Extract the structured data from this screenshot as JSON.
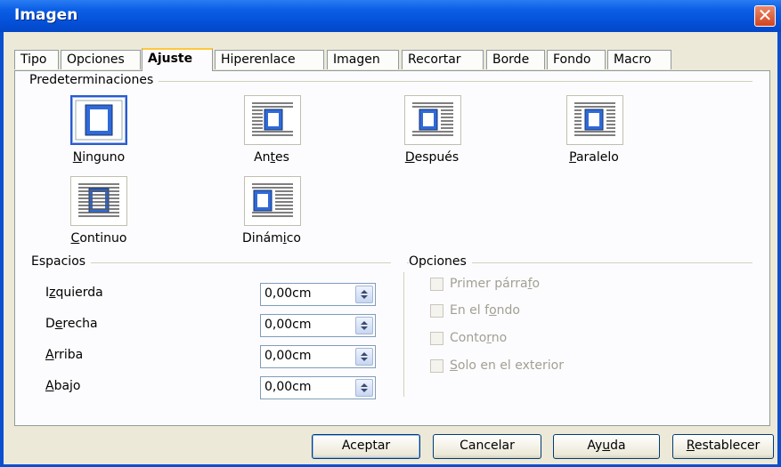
{
  "window": {
    "title": "Imagen"
  },
  "tabs": [
    {
      "label": "Tipo"
    },
    {
      "label": "Opciones"
    },
    {
      "label": "Ajuste"
    },
    {
      "label": "Hiperenlace"
    },
    {
      "label": "Imagen"
    },
    {
      "label": "Recortar"
    },
    {
      "label": "Borde"
    },
    {
      "label": "Fondo"
    },
    {
      "label": "Macro"
    }
  ],
  "active_tab": "Ajuste",
  "presets": {
    "group_label": "Predeterminaciones",
    "items": [
      {
        "pre": "",
        "u": "N",
        "post": "inguno",
        "icon": "wrap-none-icon"
      },
      {
        "pre": "An",
        "u": "t",
        "post": "es",
        "icon": "wrap-before-icon"
      },
      {
        "pre": "",
        "u": "D",
        "post": "espués",
        "icon": "wrap-after-icon"
      },
      {
        "pre": "",
        "u": "P",
        "post": "aralelo",
        "icon": "wrap-parallel-icon"
      },
      {
        "pre": "",
        "u": "C",
        "post": "ontinuo",
        "icon": "wrap-through-icon"
      },
      {
        "pre": "Dinám",
        "u": "i",
        "post": "co",
        "icon": "wrap-optimal-icon"
      }
    ],
    "selected": "Ninguno"
  },
  "spacing": {
    "group_label": "Espacios",
    "rows": [
      {
        "pre": "I",
        "u": "z",
        "post": "quierda",
        "value": "0,00cm"
      },
      {
        "pre": "D",
        "u": "e",
        "post": "recha",
        "value": "0,00cm"
      },
      {
        "pre": "",
        "u": "A",
        "post": "rriba",
        "value": "0,00cm"
      },
      {
        "pre": "",
        "u": "A",
        "post": "bajo",
        "value": "0,00cm"
      }
    ]
  },
  "options": {
    "group_label": "Opciones",
    "items": [
      {
        "pre": "Primer párra",
        "u": "f",
        "post": "o",
        "checked": false,
        "enabled": false
      },
      {
        "pre": "En el f",
        "u": "o",
        "post": "ndo",
        "checked": false,
        "enabled": false
      },
      {
        "pre": "Conto",
        "u": "r",
        "post": "no",
        "checked": false,
        "enabled": false
      },
      {
        "pre": "",
        "u": "S",
        "post": "olo en el exterior",
        "checked": false,
        "enabled": false
      }
    ]
  },
  "buttons": {
    "ok": {
      "pre": "",
      "u": "",
      "post": "Aceptar"
    },
    "cancel": {
      "pre": "",
      "u": "",
      "post": "Cancelar"
    },
    "help": {
      "pre": "Ay",
      "u": "u",
      "post": "da"
    },
    "reset": {
      "pre": "",
      "u": "R",
      "post": "establecer"
    }
  }
}
